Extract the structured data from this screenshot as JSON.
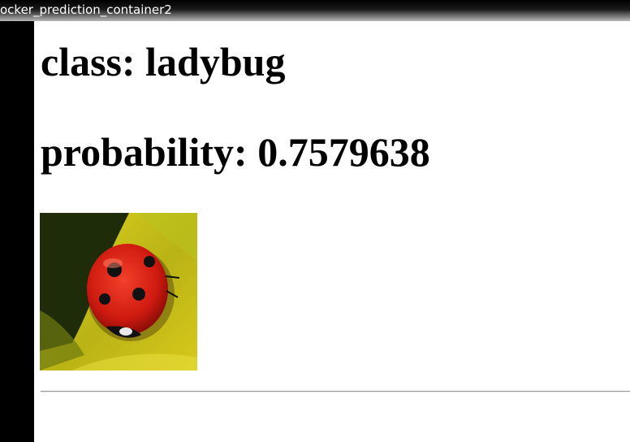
{
  "window": {
    "title": "ocker_prediction_container2"
  },
  "prediction": {
    "class_line": "class: ladybug",
    "probability_line": "probability: 0.7579638"
  },
  "image": {
    "icon": "ladybug-image",
    "colors": {
      "leaf": "#c9c21a",
      "shadow": "#1e2c0a",
      "shell": "#d61d12",
      "spots": "#111111"
    }
  }
}
